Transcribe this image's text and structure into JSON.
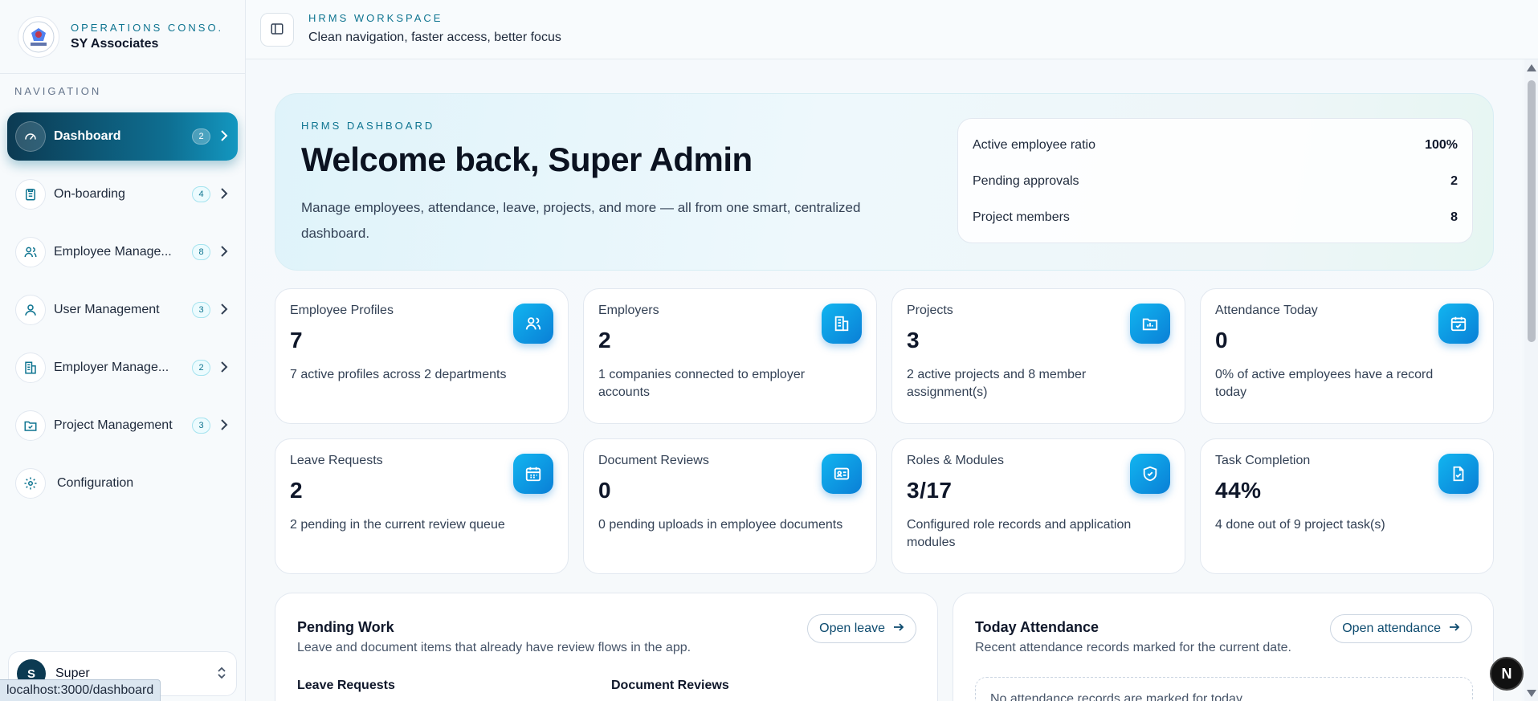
{
  "brand": {
    "kicker": "OPERATIONS CONSO...",
    "name": "SY Associates",
    "logo_text": "SY ASSOCIATES"
  },
  "nav_label": "NAVIGATION",
  "nav_items": [
    {
      "label": "Dashboard",
      "badge": "2",
      "icon": "dashboard-gauge-icon",
      "active": true
    },
    {
      "label": "On-boarding",
      "badge": "4",
      "icon": "clipboard-icon"
    },
    {
      "label": "Employee Manage...",
      "badge": "8",
      "icon": "users-icon"
    },
    {
      "label": "User Management",
      "badge": "3",
      "icon": "user-icon"
    },
    {
      "label": "Employer Manage...",
      "badge": "2",
      "icon": "building-icon"
    },
    {
      "label": "Project Management",
      "badge": "3",
      "icon": "folder-icon"
    },
    {
      "label": "Configuration",
      "icon": "gear-icon"
    }
  ],
  "user": {
    "initial": "S",
    "name": "Super"
  },
  "status_url": "localhost:3000/dashboard",
  "topbar": {
    "kicker": "HRMS WORKSPACE",
    "subtitle": "Clean navigation, faster access, better focus"
  },
  "hero": {
    "kicker": "HRMS DASHBOARD",
    "title": "Welcome back, Super Admin",
    "description": "Manage employees, attendance, leave, projects, and more — all from one smart, centralized dashboard.",
    "stats": [
      {
        "label": "Active employee ratio",
        "value": "100%"
      },
      {
        "label": "Pending approvals",
        "value": "2"
      },
      {
        "label": "Project members",
        "value": "8"
      }
    ]
  },
  "stat_cards": [
    {
      "label": "Employee Profiles",
      "value": "7",
      "note": "7 active profiles across 2 departments",
      "icon": "users-icon"
    },
    {
      "label": "Employers",
      "value": "2",
      "note": "1 companies connected to employer accounts",
      "icon": "building-icon"
    },
    {
      "label": "Projects",
      "value": "3",
      "note": "2 active projects and 8 member assignment(s)",
      "icon": "folder-icon"
    },
    {
      "label": "Attendance Today",
      "value": "0",
      "note": "0% of active employees have a record today",
      "icon": "calendar-check-icon"
    },
    {
      "label": "Leave Requests",
      "value": "2",
      "note": "2 pending in the current review queue",
      "icon": "calendar-icon"
    },
    {
      "label": "Document Reviews",
      "value": "0",
      "note": "0 pending uploads in employee documents",
      "icon": "id-card-icon"
    },
    {
      "label": "Roles & Modules",
      "value": "3/17",
      "note": "Configured role records and application modules",
      "icon": "shield-check-icon"
    },
    {
      "label": "Task Completion",
      "value": "44%",
      "note": "4 done out of 9 project task(s)",
      "icon": "file-check-icon"
    }
  ],
  "pending_work": {
    "title": "Pending Work",
    "subtitle": "Leave and document items that already have review flows in the app.",
    "button": "Open leave",
    "col1": "Leave Requests",
    "col2": "Document Reviews"
  },
  "today_attendance": {
    "title": "Today Attendance",
    "subtitle": "Recent attendance records marked for the current date.",
    "button": "Open attendance",
    "empty": "No attendance records are marked for today."
  },
  "floating_badge": "N",
  "colors": {
    "accent": "#0e7490",
    "active_nav": "#0e6f92",
    "icon_tile": "#0a8fe0"
  }
}
